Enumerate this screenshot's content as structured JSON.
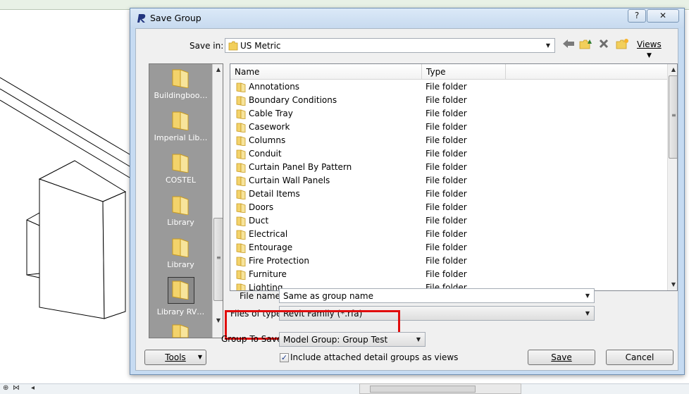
{
  "dialog": {
    "title": "Save Group",
    "help_glyph": "?",
    "close_glyph": "✕",
    "icon": "revit-logo-icon"
  },
  "save_in": {
    "label": "Save in:",
    "value": "US Metric"
  },
  "toolbar": {
    "views_label": "Views",
    "icons": [
      "back-arrow-icon",
      "up-folder-icon",
      "delete-icon",
      "new-folder-icon",
      "views-menu-icon"
    ]
  },
  "places": [
    {
      "label": "Buildingboo…"
    },
    {
      "label": "Imperial Lib…"
    },
    {
      "label": "COSTEL"
    },
    {
      "label": "Library"
    },
    {
      "label": "Library"
    },
    {
      "label": "Library RV…"
    }
  ],
  "file_list": {
    "columns": [
      "Name",
      "Type"
    ],
    "rows": [
      {
        "name": "Annotations",
        "type": "File folder"
      },
      {
        "name": "Boundary Conditions",
        "type": "File folder"
      },
      {
        "name": "Cable Tray",
        "type": "File folder"
      },
      {
        "name": "Casework",
        "type": "File folder"
      },
      {
        "name": "Columns",
        "type": "File folder"
      },
      {
        "name": "Conduit",
        "type": "File folder"
      },
      {
        "name": "Curtain Panel By Pattern",
        "type": "File folder"
      },
      {
        "name": "Curtain Wall Panels",
        "type": "File folder"
      },
      {
        "name": "Detail Items",
        "type": "File folder"
      },
      {
        "name": "Doors",
        "type": "File folder"
      },
      {
        "name": "Duct",
        "type": "File folder"
      },
      {
        "name": "Electrical",
        "type": "File folder"
      },
      {
        "name": "Entourage",
        "type": "File folder"
      },
      {
        "name": "Fire Protection",
        "type": "File folder"
      },
      {
        "name": "Furniture",
        "type": "File folder"
      },
      {
        "name": "Lighting",
        "type": "File folder"
      }
    ]
  },
  "file_name": {
    "label": "File name:",
    "value": "Same as group name"
  },
  "files_of_type": {
    "label": "Files of type:",
    "value": "Revit Family  (*.rfa)"
  },
  "group_to_save": {
    "label": "Group To Save:",
    "value": "Model Group: Group Test"
  },
  "include_detail": {
    "label": "Include attached detail groups as views",
    "checked": true
  },
  "buttons": {
    "tools": "Tools",
    "save": "Save",
    "cancel": "Cancel"
  },
  "colors": {
    "highlight": "#e10d0d",
    "titlebar": "#c7daef",
    "places_bg": "#9a9a9a"
  }
}
